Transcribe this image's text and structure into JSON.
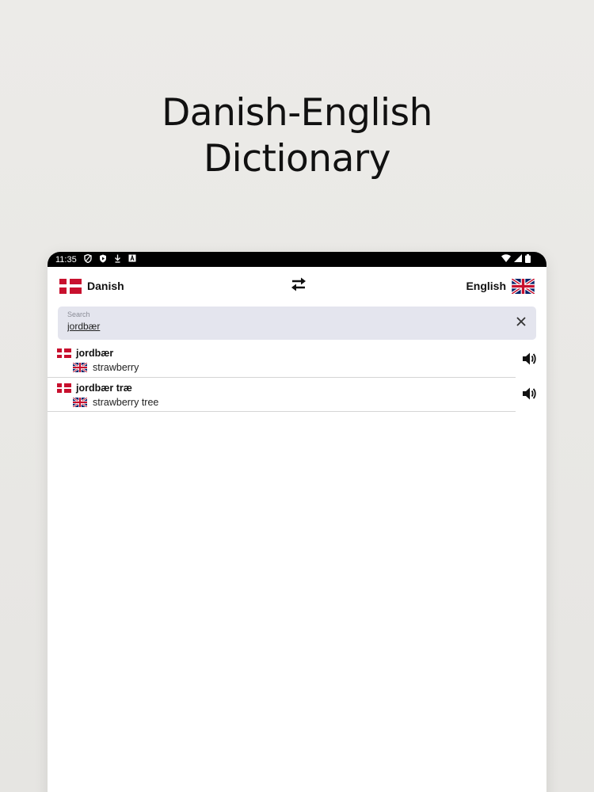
{
  "headline": {
    "line1": "Danish-English",
    "line2": "Dictionary"
  },
  "status_bar": {
    "time": "11:35",
    "left_icons": [
      "shield-icon",
      "play-protect-icon",
      "download-icon",
      "keyboard-a-icon"
    ],
    "right_icons": [
      "wifi-icon",
      "signal-icon",
      "battery-icon"
    ]
  },
  "language_bar": {
    "source": {
      "label": "Danish",
      "flag": "denmark-flag-icon"
    },
    "target": {
      "label": "English",
      "flag": "uk-flag-icon"
    },
    "swap_icon": "⇄"
  },
  "search": {
    "label": "Search",
    "value": "jordbær",
    "clear_icon": "✕"
  },
  "results": [
    {
      "word": "jordbær",
      "translation": "strawberry"
    },
    {
      "word": "jordbær træ",
      "translation": "strawberry tree"
    }
  ],
  "colors": {
    "danish_red": "#c8102e",
    "uk_blue": "#012169",
    "uk_red": "#c8102e",
    "search_bg": "#e4e5ee"
  }
}
